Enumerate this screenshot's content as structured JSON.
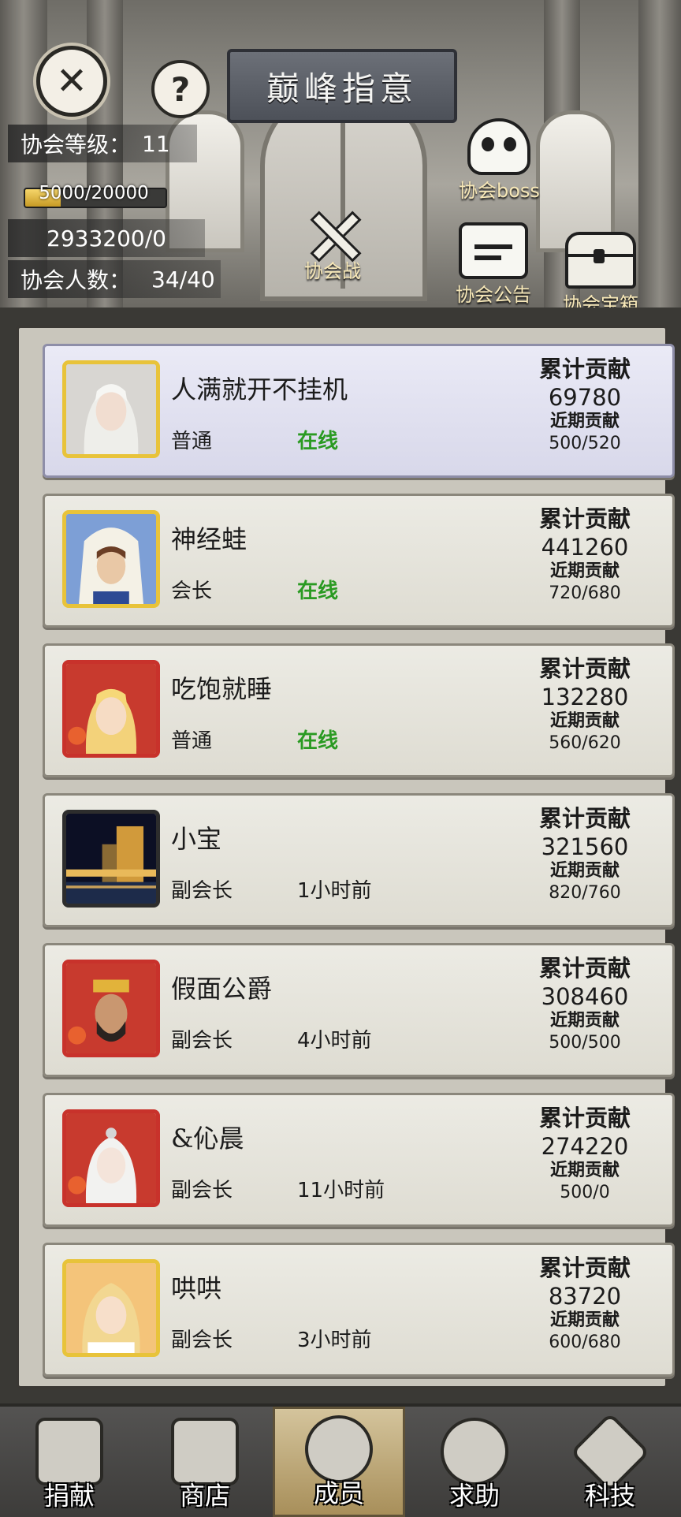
{
  "header": {
    "title": "巅峰指意",
    "close_icon": "close-icon",
    "help_icon": "help-icon",
    "guild_level_label": "协会等级：",
    "guild_level_value": "11",
    "exp_text": "5000/20000",
    "exp_fraction": 0.25,
    "funds_text": "2933200/0",
    "member_count_label": "协会人数：",
    "member_count_value": "34/40",
    "boss_label": "协会boss",
    "war_label": "协会战",
    "notice_label": "协会公告",
    "chest_label": "协会宝箱"
  },
  "members": [
    {
      "name": "人满就开不挂机",
      "role": "普通",
      "status": "在线",
      "online": true,
      "total_label": "累计贡献",
      "total": "69780",
      "recent_label": "近期贡献",
      "recent": "500/520"
    },
    {
      "name": "神经蛙",
      "role": "会长",
      "status": "在线",
      "online": true,
      "total_label": "累计贡献",
      "total": "441260",
      "recent_label": "近期贡献",
      "recent": "720/680"
    },
    {
      "name": "吃饱就睡",
      "role": "普通",
      "status": "在线",
      "online": true,
      "total_label": "累计贡献",
      "total": "132280",
      "recent_label": "近期贡献",
      "recent": "560/620"
    },
    {
      "name": "小宝",
      "role": "副会长",
      "status": "1小时前",
      "online": false,
      "total_label": "累计贡献",
      "total": "321560",
      "recent_label": "近期贡献",
      "recent": "820/760"
    },
    {
      "name": "假面公爵",
      "role": "副会长",
      "status": "4小时前",
      "online": false,
      "total_label": "累计贡献",
      "total": "308460",
      "recent_label": "近期贡献",
      "recent": "500/500"
    },
    {
      "name": "&伈晨",
      "role": "副会长",
      "status": "11小时前",
      "online": false,
      "total_label": "累计贡献",
      "total": "274220",
      "recent_label": "近期贡献",
      "recent": "500/0"
    },
    {
      "name": "哄哄",
      "role": "副会长",
      "status": "3小时前",
      "online": false,
      "total_label": "累计贡献",
      "total": "83720",
      "recent_label": "近期贡献",
      "recent": "600/680"
    }
  ],
  "nav": {
    "tabs": [
      {
        "label": "捐献",
        "icon": "donate-icon"
      },
      {
        "label": "商店",
        "icon": "shop-icon"
      },
      {
        "label": "成员",
        "icon": "members-icon",
        "active": true
      },
      {
        "label": "求助",
        "icon": "help-request-icon"
      },
      {
        "label": "科技",
        "icon": "tech-icon"
      }
    ]
  },
  "colors": {
    "online": "#2a9a22",
    "gold_border": "#e8c33a",
    "exp_fill": "#d9b13e"
  }
}
